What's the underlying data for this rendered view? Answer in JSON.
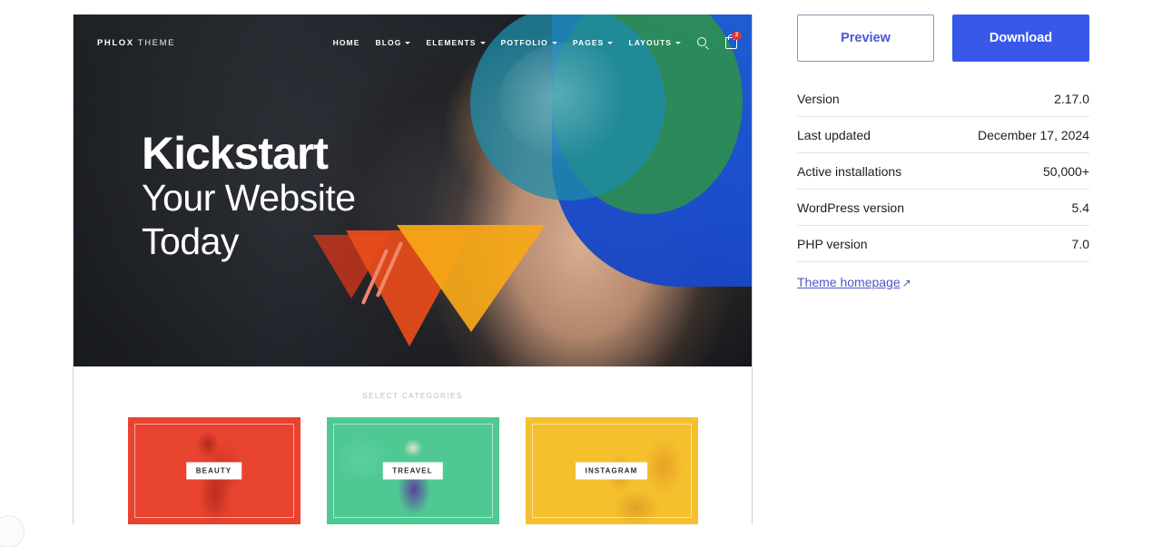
{
  "theme_preview": {
    "nav": {
      "logo_bold": "PHLOX",
      "logo_light": " THEME",
      "items": [
        {
          "label": "HOME",
          "has_caret": false
        },
        {
          "label": "BLOG",
          "has_caret": true
        },
        {
          "label": "ELEMENTS",
          "has_caret": true
        },
        {
          "label": "POTFOLIO",
          "has_caret": true
        },
        {
          "label": "PAGES",
          "has_caret": true
        },
        {
          "label": "LAYOUTS",
          "has_caret": true
        }
      ],
      "search_icon": "search-icon",
      "cart_icon": "shopping-bag-icon",
      "cart_badge": "2"
    },
    "hero": {
      "headline_line1": "Kickstart",
      "headline_line2": "Your Website",
      "headline_line3": "Today"
    },
    "categories": {
      "section_title": "SELECT CATEGORIES",
      "cards": [
        {
          "label": "BEAUTY",
          "color": "#e8432f"
        },
        {
          "label": "TREAVEL",
          "color": "#4fc894"
        },
        {
          "label": "INSTAGRAM",
          "color": "#f5c02e"
        }
      ]
    }
  },
  "sidebar": {
    "preview_button": "Preview",
    "download_button": "Download",
    "meta": [
      {
        "label": "Version",
        "value": "2.17.0"
      },
      {
        "label": "Last updated",
        "value": "December 17, 2024"
      },
      {
        "label": "Active installations",
        "value": "50,000+"
      },
      {
        "label": "WordPress version",
        "value": "5.4"
      },
      {
        "label": "PHP version",
        "value": "7.0"
      }
    ],
    "homepage_link": "Theme homepage",
    "homepage_arrow": "↗"
  },
  "colors": {
    "accent_blue": "#3858e9",
    "link_indigo": "#4b57cf",
    "badge_red": "#e0392c"
  }
}
